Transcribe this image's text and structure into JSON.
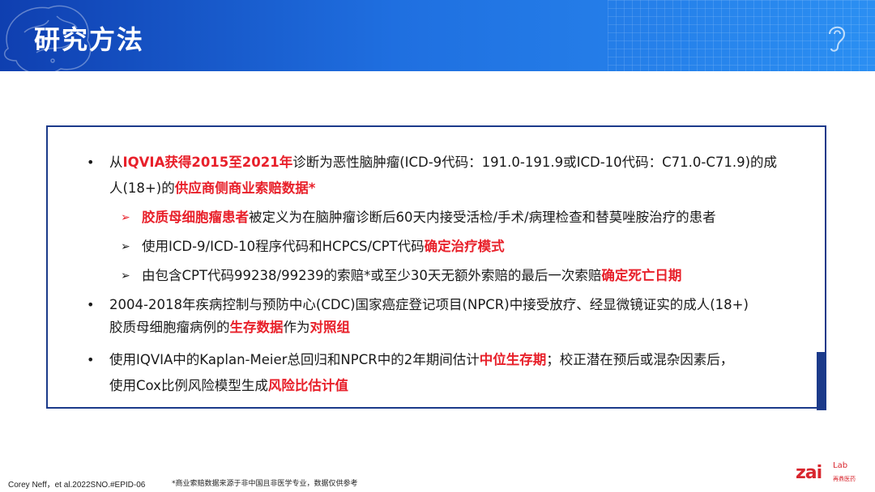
{
  "header": {
    "title": "研究方法"
  },
  "bullets": [
    {
      "line1": [
        "从",
        "IQVIA获得2015至2021年",
        "诊断为恶性脑肿瘤(ICD-9代码：191.0-191.9或ICD-10代码：C71.0-C71.9)的成"
      ],
      "line2": [
        "人(18+)的",
        "供应商侧商业索赔数据*"
      ]
    },
    {
      "line1": [
        "2004-2018年疾病控制与预防中心(CDC)国家癌症登记项目(NPCR)中接受放疗、经显微镜证实的成人(18+)"
      ],
      "line2": [
        "胶质母细胞瘤病例的",
        "生存数据",
        "作为",
        "对照组"
      ]
    },
    {
      "line1": [
        "使用IQVIA中的Kaplan-Meier总回归和NPCR中的2年期间估计",
        "中位生存期",
        "；校正潜在预后或混杂因素后，"
      ],
      "line2": [
        "使用Cox比例风险模型生成",
        "风险比估计值"
      ]
    }
  ],
  "subbullets": [
    [
      "胶质母细胞瘤患者",
      "被定义为在脑肿瘤诊断后60天内接受活检/手术/病理检查和替莫唑胺治疗的患者"
    ],
    [
      "使用ICD-9/ICD-10程序代码和HCPCS/CPT代码",
      "确定治疗模式"
    ],
    [
      "由包含CPT代码99238/99239的索赔*或至少30天无额外索赔的最后一次索赔",
      "确定死亡日期"
    ]
  ],
  "footer": {
    "citation": "Corey Neff，et al.2022SNO.#EPID-06",
    "note": "*商业索赔数据来源于非中国且非医学专业，数据仅供参考"
  },
  "logo": {
    "name": "zai",
    "lab": "Lab",
    "sub": "再鼎医药"
  },
  "colors": {
    "header_start": "#0f3fb0",
    "header_end": "#2b8ff2",
    "box_border": "#1b3a8a",
    "highlight_red": "#e8202a"
  },
  "icons": {
    "bullet": "bullet-dot-icon",
    "sub_bullet": "arrow-right-icon",
    "header_left": "brain-outline-icon",
    "header_right": "ear-outline-icon"
  }
}
